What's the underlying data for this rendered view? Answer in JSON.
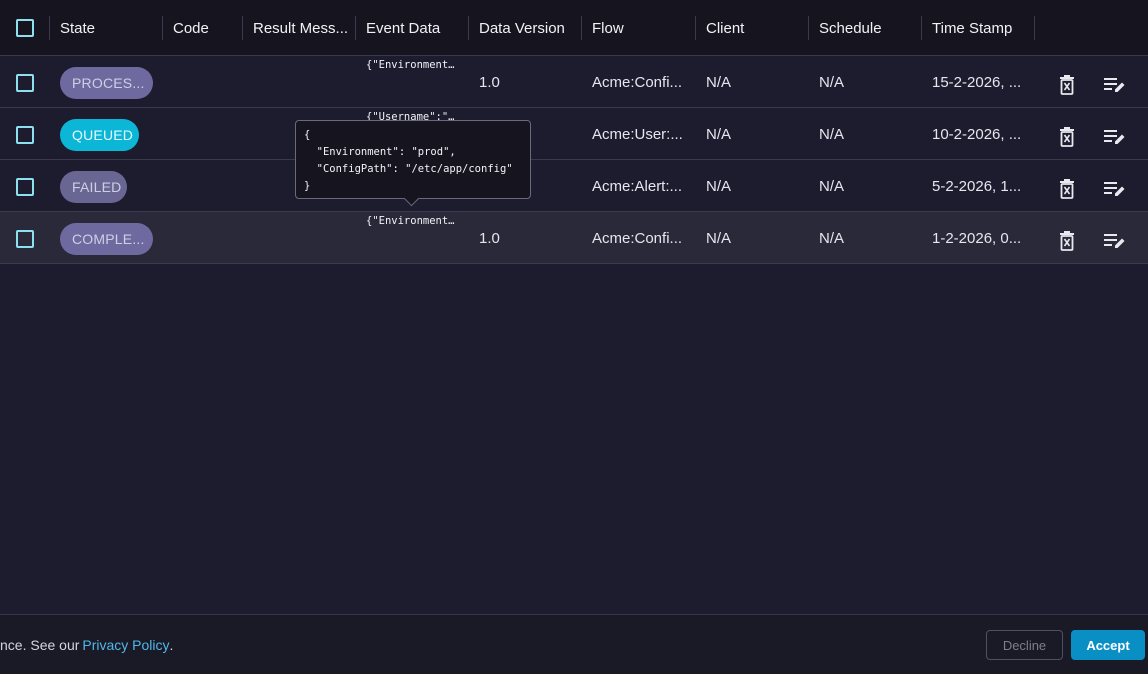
{
  "table": {
    "headers": {
      "state": "State",
      "code": "Code",
      "result_message": "Result Mess...",
      "event_data": "Event Data",
      "data_version": "Data Version",
      "flow": "Flow",
      "client": "Client",
      "schedule": "Schedule",
      "time_stamp": "Time Stamp"
    },
    "rows": [
      {
        "state": "PROCES...",
        "state_color": "#6e6aa0",
        "state_text_color": "#cfcfe3",
        "code": "",
        "result_message": "",
        "event_data": "{\"Environment…",
        "data_version": "1.0",
        "flow": "Acme:Confi...",
        "client": "N/A",
        "schedule": "N/A",
        "time_stamp": "15-2-2026, ..."
      },
      {
        "state": "QUEUED",
        "state_color": "#0cb6d6",
        "state_text_color": "#e9fbff",
        "code": "",
        "result_message": "",
        "event_data": "{\"Username\":\"…",
        "data_version": "",
        "flow": "Acme:User:...",
        "client": "N/A",
        "schedule": "N/A",
        "time_stamp": "10-2-2026, ..."
      },
      {
        "state": "FAILED",
        "state_color": "#6a6694",
        "state_text_color": "#cfcfe3",
        "code": "",
        "result_message": "",
        "event_data": "",
        "data_version": "",
        "flow": "Acme:Alert:...",
        "client": "N/A",
        "schedule": "N/A",
        "time_stamp": "5-2-2026, 1..."
      },
      {
        "state": "COMPLE...",
        "state_color": "#6e6aa0",
        "state_text_color": "#cfcfe3",
        "code": "",
        "result_message": "",
        "event_data": "{\"Environment…",
        "data_version": "1.0",
        "flow": "Acme:Confi...",
        "client": "N/A",
        "schedule": "N/A",
        "time_stamp": "1-2-2026, 0..."
      }
    ]
  },
  "tooltip": {
    "text": "{\n  \"Environment\": \"prod\",\n  \"ConfigPath\": \"/etc/app/config\"\n}"
  },
  "icons": {
    "delete": "delete-icon",
    "edit": "edit-list-icon"
  },
  "footer": {
    "text": "nce. See our",
    "link": "Privacy Policy",
    "after_link": ".",
    "decline": "Decline",
    "accept": "Accept"
  },
  "colors": {
    "accent": "#0a8fc4",
    "checkbox": "#8fe0ee",
    "link": "#4fb8e8"
  }
}
